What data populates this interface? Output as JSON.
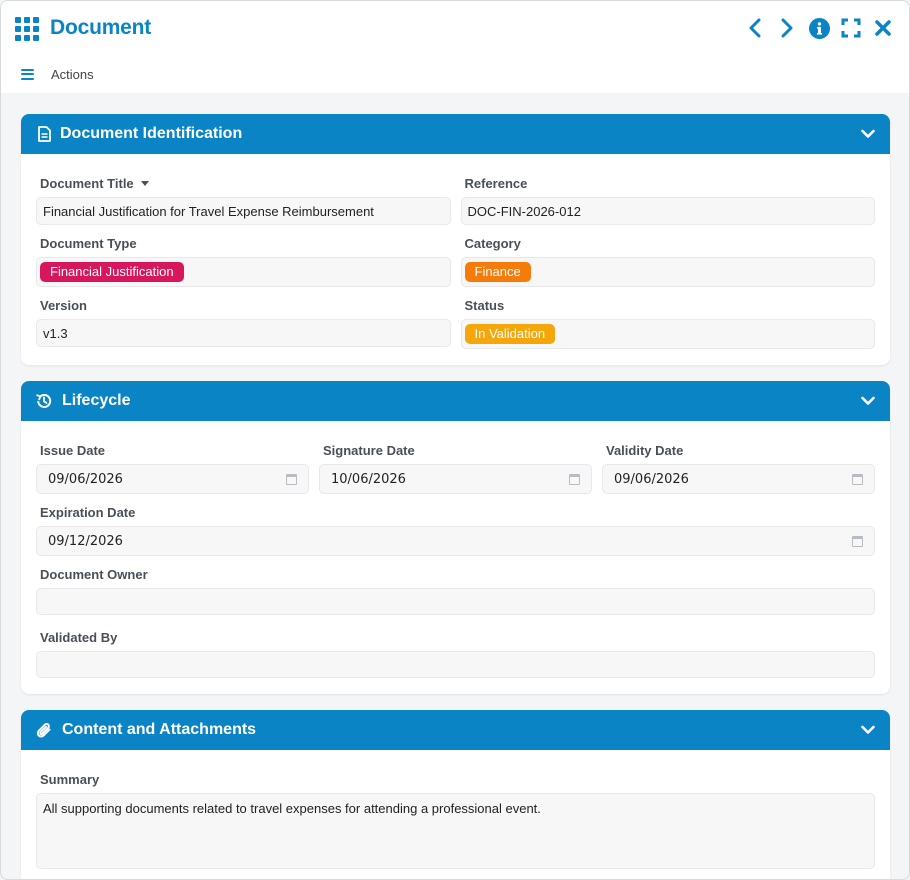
{
  "window": {
    "title": "Document",
    "icons": [
      "apps-grid-icon",
      "chevron-left-icon",
      "chevron-right-icon",
      "info-icon",
      "fullscreen-icon",
      "close-icon"
    ]
  },
  "toolbar": {
    "actions_label": "Actions"
  },
  "colors": {
    "primary": "#0b84c6",
    "financial_badge": "#d6175b",
    "finance_badge": "#f57c0a",
    "status_badge": "#f5a60a"
  },
  "identification": {
    "title": "Document Identification",
    "document_title_label": "Document Title",
    "document_title_value": "Financial Justification for Travel Expense Reimbursement",
    "reference_label": "Reference",
    "reference_value": "DOC-FIN-2026-012",
    "document_type_label": "Document Type",
    "document_type_value": "Financial Justification",
    "category_label": "Category",
    "category_value": "Finance",
    "version_label": "Version",
    "version_value": "v1.3",
    "status_label": "Status",
    "status_value": "In Validation"
  },
  "lifecycle": {
    "title": "Lifecycle",
    "issue_date_label": "Issue Date",
    "issue_date_value": "09/06/2026",
    "signature_date_label": "Signature Date",
    "signature_date_value": "10/06/2026",
    "validity_date_label": "Validity Date",
    "validity_date_value": "09/06/2026",
    "expiration_date_label": "Expiration Date",
    "expiration_date_value": "09/12/2026",
    "document_owner_label": "Document Owner",
    "document_owner_value": "",
    "validated_by_label": "Validated By",
    "validated_by_value": ""
  },
  "content": {
    "title": "Content and Attachments",
    "summary_label": "Summary",
    "summary_value": "All supporting documents related to travel expenses for attending a professional event."
  }
}
